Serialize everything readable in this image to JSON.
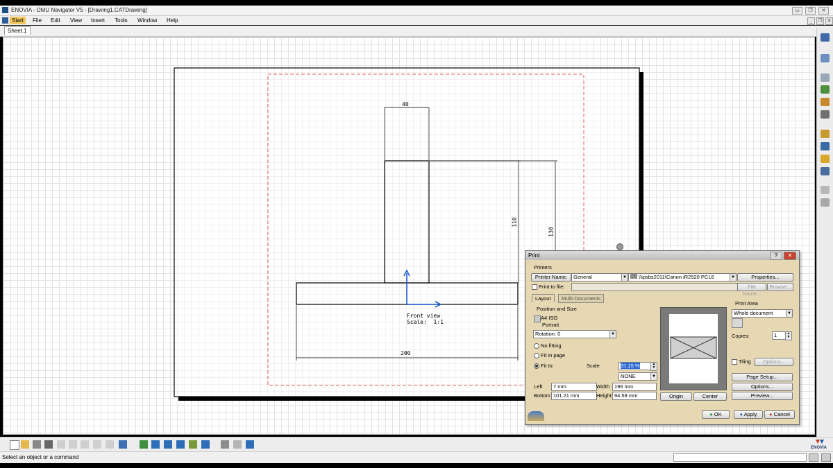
{
  "window": {
    "title": "ENOVIA - DMU Navigator V5 - [Drawing1.CATDrawing]",
    "controls": [
      "minimize",
      "restore",
      "close"
    ]
  },
  "menubar": {
    "items": [
      "Start",
      "File",
      "Edit",
      "View",
      "Insert",
      "Tools",
      "Window",
      "Help"
    ],
    "active": "Start"
  },
  "sheet_tab": "Sheet.1",
  "drawing": {
    "dim_top": "40",
    "dim_inner_height": "110",
    "dim_outer_height": "130",
    "dim_bottom": "200",
    "view_label": "Front view",
    "scale_label": "Scale:  1:1"
  },
  "print_dialog": {
    "title": "Print",
    "printers_group": "Printers",
    "printer_name_btn": "Printer Name:",
    "printer_type": "General",
    "printer_path": "\\\\ipsbs2011\\Canon iR2520 PCL6",
    "properties_btn": "Properties...",
    "print_to_file": "Print to file:",
    "file_browse_btn": "File Name...",
    "file_browse_btn2": "Browse...",
    "tabs": [
      "Layout",
      "Multi-Documents"
    ],
    "active_tab": "Layout",
    "position_group": "Position and Size",
    "paper": "A4 ISO",
    "orientation": "Portrait",
    "rotation": "Rotation: 0",
    "no_fitting": "No fitting",
    "fit_in_page": "Fit in page",
    "fit_to": "Fit to:",
    "scale_label": "Scale",
    "scale_value": "31.15 %",
    "scale_preset": "NONE",
    "left_label": "Left",
    "left_value": "7 mm",
    "bottom_label": "Bottom",
    "bottom_value": "101.21 mm",
    "width_label": "Width",
    "width_value": "196 mm",
    "height_label": "Height",
    "height_value": "94.58 mm",
    "origin_btn": "Origin",
    "center_btn": "Center",
    "print_area_group": "Print Area",
    "print_area_value": "Whole document",
    "copies_label": "Copies:",
    "copies_value": "1",
    "tiling_label": "Tiling",
    "tiling_options_btn": "Options...",
    "page_setup_btn": "Page Setup...",
    "options_btn": "Options...",
    "preview_btn": "Preview...",
    "ok_btn": "OK",
    "apply_btn": "Apply",
    "cancel_btn": "Cancel"
  },
  "statusbar": {
    "message": "Select an object or a command"
  },
  "brand": "ENOVIA",
  "colors": {
    "accent_menu": "#f3c65c",
    "dialog_bg": "#e7d8b4",
    "frame_dash": "#e0605a",
    "axis": "#1f5fd6"
  }
}
